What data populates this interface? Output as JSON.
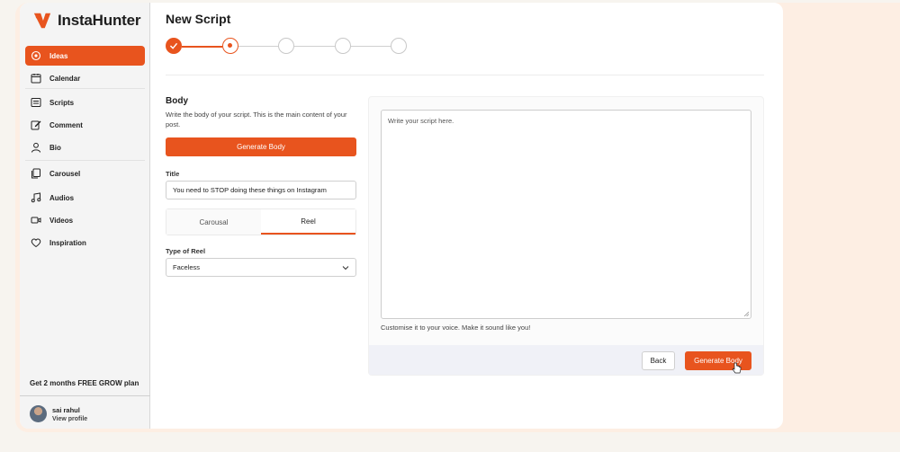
{
  "brand": {
    "name": "InstaHunter",
    "accent": "#e8541e"
  },
  "sidebar": {
    "items": [
      {
        "label": "Ideas",
        "icon": "lightbulb-icon",
        "active": true
      },
      {
        "label": "Calendar",
        "icon": "calendar-icon"
      },
      {
        "label": "Scripts",
        "icon": "scripts-icon"
      },
      {
        "label": "Comment",
        "icon": "edit-icon"
      },
      {
        "label": "Bio",
        "icon": "user-icon"
      },
      {
        "label": "Carousel",
        "icon": "copy-icon"
      },
      {
        "label": "Audios",
        "icon": "music-icon"
      },
      {
        "label": "Videos",
        "icon": "video-icon"
      },
      {
        "label": "Inspiration",
        "icon": "heart-icon"
      }
    ],
    "promo": "Get 2 months FREE GROW plan",
    "profile": {
      "name": "sai rahul",
      "link": "View profile"
    }
  },
  "page": {
    "title": "New Script"
  },
  "stepper": {
    "total": 5,
    "completed": 1,
    "current": 2
  },
  "form": {
    "section_title": "Body",
    "section_desc": "Write the body of your script. This is the main content of your post.",
    "generate_label": "Generate Body",
    "title_label": "Title",
    "title_value": "You need to STOP doing these things on Instagram",
    "tabs": [
      {
        "label": "Carousal"
      },
      {
        "label": "Reel"
      }
    ],
    "active_tab": "Reel",
    "reel_type_label": "Type of Reel",
    "reel_type_value": "Faceless"
  },
  "editor": {
    "placeholder": "Write your script here.",
    "hint": "Customise it to your voice. Make it sound like you!",
    "back_label": "Back",
    "generate_label": "Generate Body"
  }
}
